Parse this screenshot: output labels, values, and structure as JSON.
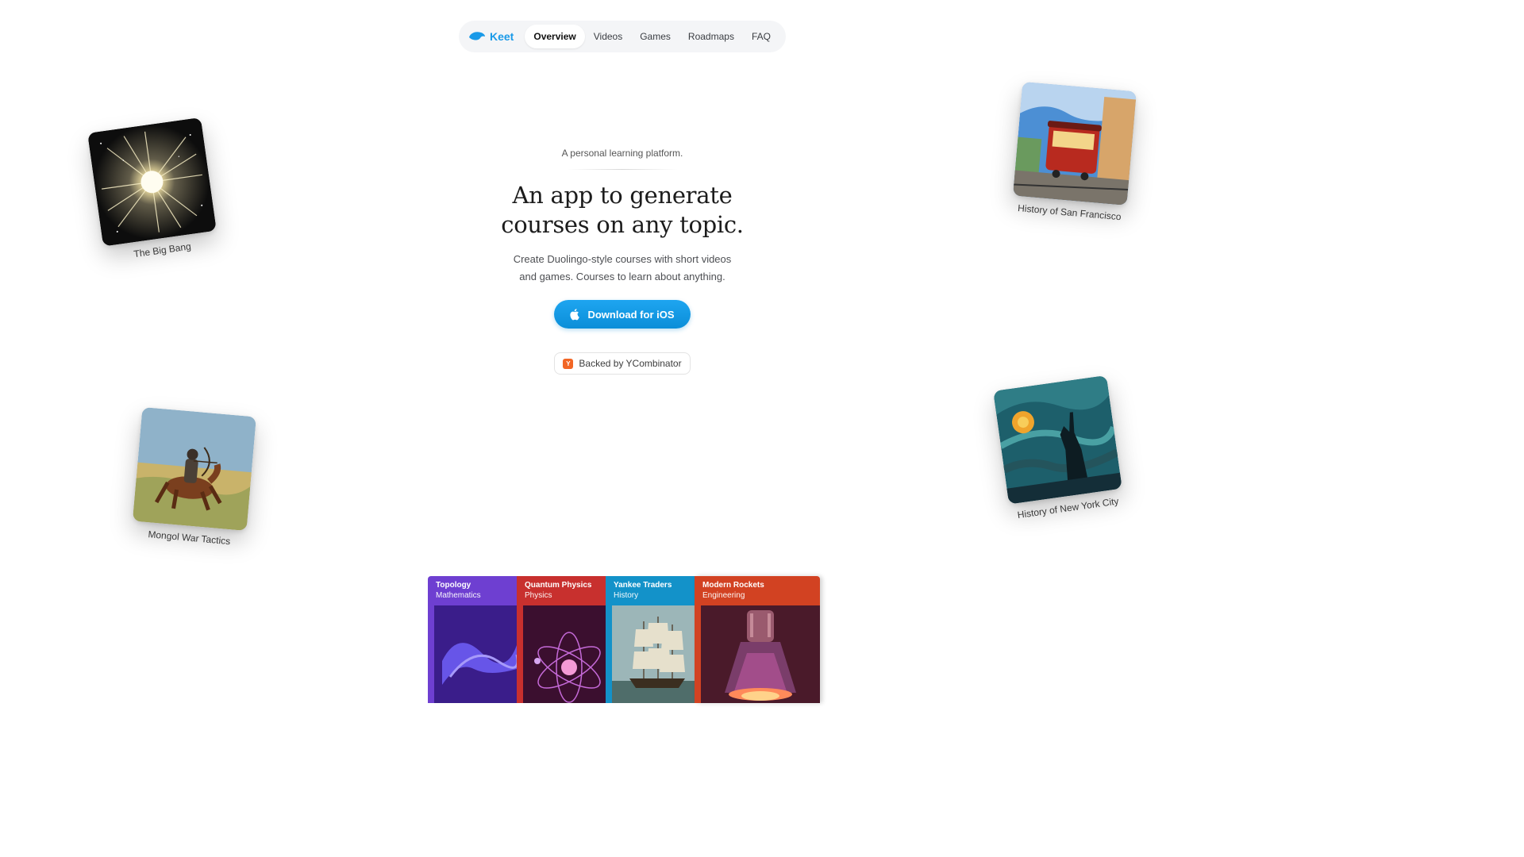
{
  "nav": {
    "brand": "Keet",
    "items": [
      {
        "label": "Overview",
        "active": true
      },
      {
        "label": "Videos"
      },
      {
        "label": "Games"
      },
      {
        "label": "Roadmaps"
      },
      {
        "label": "FAQ"
      }
    ]
  },
  "hero": {
    "tagline": "A personal learning platform.",
    "headline_line1": "An app to generate",
    "headline_line2": "courses on any topic.",
    "subtitle_line1": "Create Duolingo-style courses with short videos",
    "subtitle_line2": "and games. Courses to learn about anything.",
    "cta_label": "Download for iOS",
    "backed_label": "Backed by YCombinator",
    "yc_letter": "Y"
  },
  "floating_courses": [
    {
      "label": "The Big Bang",
      "icon": "starburst-image"
    },
    {
      "label": "History of San Francisco",
      "icon": "cable-car-image"
    },
    {
      "label": "Mongol War Tactics",
      "icon": "horse-archer-image"
    },
    {
      "label": "History of New York City",
      "icon": "statue-of-liberty-image"
    }
  ],
  "course_strip": [
    {
      "title": "Topology",
      "category": "Mathematics",
      "color": "#6e3fd1"
    },
    {
      "title": "Quantum Physics",
      "category": "Physics",
      "color": "#c8302e"
    },
    {
      "title": "Yankee Traders",
      "category": "History",
      "color": "#1392c9"
    },
    {
      "title": "Modern Rockets",
      "category": "Engineering",
      "color": "#d24222"
    }
  ],
  "colors": {
    "accent": "#1a9ae8",
    "yc": "#f26625"
  }
}
